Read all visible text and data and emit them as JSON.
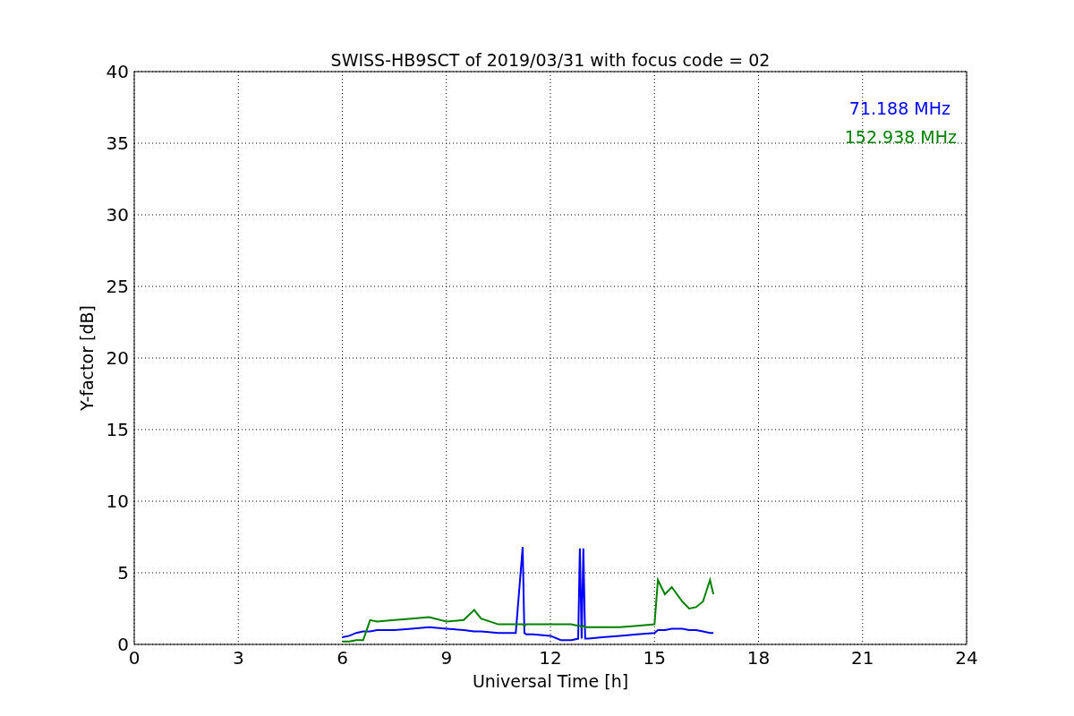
{
  "chart_data": {
    "type": "line",
    "title": "SWISS-HB9SCT of 2019/03/31 with focus code = 02",
    "xlabel": "Universal Time [h]",
    "ylabel": "Y-factor [dB]",
    "x": [
      6,
      6.2,
      6.4,
      6.6,
      6.8,
      7,
      7.5,
      8,
      8.5,
      9,
      9.5,
      9.8,
      10,
      10.5,
      11,
      11.2,
      11.25,
      11.3,
      11.5,
      12,
      12.3,
      12.6,
      12.8,
      12.85,
      12.9,
      12.95,
      13,
      13.1,
      13.5,
      14,
      14.5,
      15,
      15.1,
      15.3,
      15.5,
      15.8,
      16,
      16.2,
      16.4,
      16.6,
      16.7
    ],
    "series": [
      {
        "name": "71.188 MHz",
        "color": "#0000ff",
        "values": [
          0.5,
          0.6,
          0.8,
          0.9,
          0.9,
          1.0,
          1.0,
          1.1,
          1.2,
          1.1,
          1.0,
          0.9,
          0.9,
          0.8,
          0.8,
          6.8,
          0.8,
          0.7,
          0.7,
          0.6,
          0.3,
          0.3,
          0.4,
          6.7,
          0.4,
          6.7,
          0.4,
          0.4,
          0.5,
          0.6,
          0.7,
          0.8,
          1.0,
          1.0,
          1.1,
          1.1,
          1.0,
          1.0,
          0.9,
          0.8,
          0.8
        ]
      },
      {
        "name": "152.938 MHz",
        "color": "#008000",
        "values": [
          0.2,
          0.2,
          0.3,
          0.3,
          1.7,
          1.6,
          1.7,
          1.8,
          1.9,
          1.6,
          1.7,
          2.4,
          1.8,
          1.4,
          1.4,
          1.4,
          1.3,
          1.4,
          1.4,
          1.4,
          1.4,
          1.4,
          1.3,
          1.3,
          1.2,
          1.3,
          1.2,
          1.2,
          1.2,
          1.2,
          1.3,
          1.4,
          4.5,
          3.5,
          4.0,
          3.0,
          2.5,
          2.6,
          3.0,
          4.5,
          3.5
        ]
      }
    ],
    "grid": true,
    "xlim": [
      0,
      24
    ],
    "ylim": [
      0,
      40
    ],
    "xticks": [
      0,
      3,
      6,
      9,
      12,
      15,
      18,
      21,
      24
    ],
    "yticks": [
      0,
      5,
      10,
      15,
      20,
      25,
      30,
      35,
      40
    ]
  }
}
